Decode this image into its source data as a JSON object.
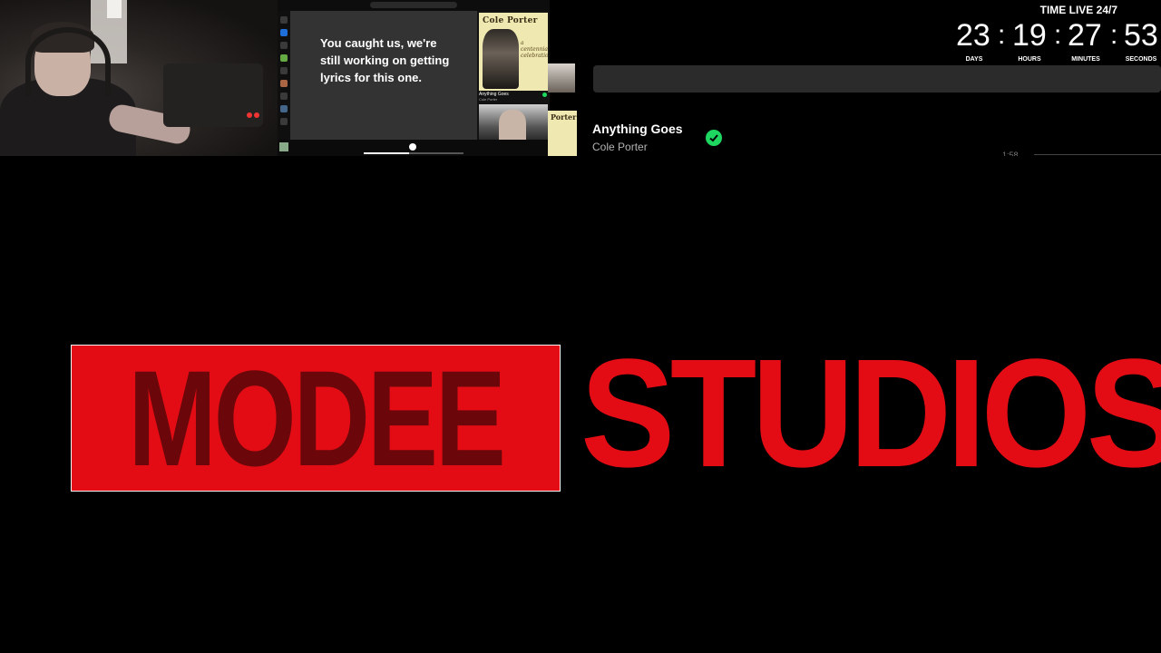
{
  "spotify": {
    "lyrics_message": "You caught us, we're still working on getting lyrics for this one.",
    "mini_album_title": "Cole Porter",
    "mini_album_subtitle": "a centennial celebration",
    "mini_track": "Anything Goes",
    "mini_artist": "Cole Porter",
    "progress": 0.45
  },
  "now_playing": {
    "title": "Anything Goes",
    "artist": "Cole Porter",
    "thumb_label": "Porter",
    "saved": true,
    "time_hint": "1:58"
  },
  "countdown": {
    "title": "TIME LIVE 24/7",
    "days": "23",
    "hours": "19",
    "minutes": "27",
    "seconds": "53",
    "separator": ":",
    "labels": {
      "days": "DAYS",
      "hours": "HOURS",
      "minutes": "MINUTES",
      "seconds": "SECONDS"
    }
  },
  "logo": {
    "part1": "MODEE",
    "part2": "STUDIOS",
    "color": "#e30c14"
  },
  "colors": {
    "spotify_green": "#1ed760",
    "lyrics_bg": "#333333"
  }
}
